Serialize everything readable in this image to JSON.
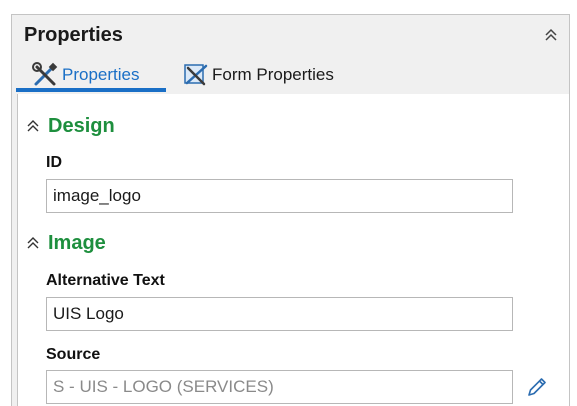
{
  "panel": {
    "title": "Properties"
  },
  "tabs": [
    {
      "label": "Properties",
      "icon": "tools-icon",
      "active": true
    },
    {
      "label": "Form Properties",
      "icon": "form-tools-icon",
      "active": false
    }
  ],
  "sections": {
    "design": {
      "title": "Design",
      "fields": {
        "id": {
          "label": "ID",
          "value": "image_logo"
        }
      }
    },
    "image": {
      "title": "Image",
      "fields": {
        "alt_text": {
          "label": "Alternative Text",
          "value": "UIS Logo"
        },
        "source": {
          "label": "Source",
          "value": "S - UIS - LOGO (SERVICES)"
        }
      }
    }
  },
  "colors": {
    "accent": "#1a6fc6",
    "section_title": "#1e8f3e",
    "panel_bg": "#f0f0f0"
  }
}
